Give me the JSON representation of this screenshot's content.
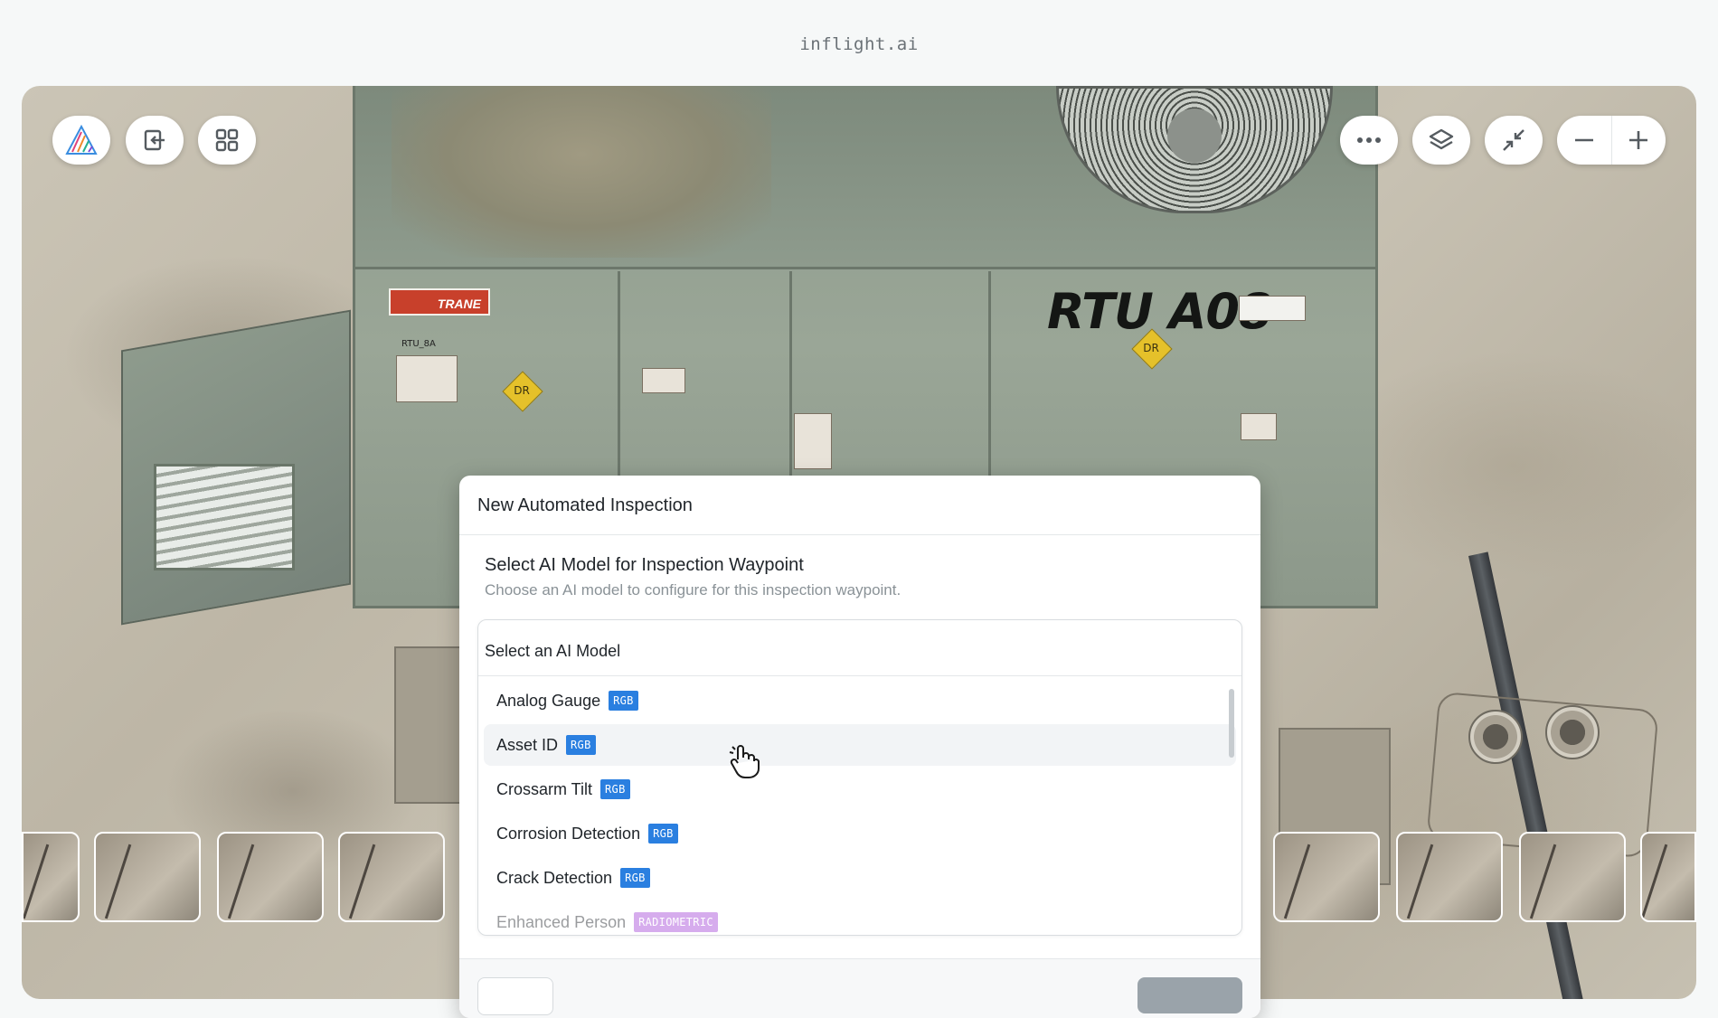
{
  "site": {
    "title": "inflight.ai"
  },
  "scene": {
    "unit_label": "RTU A08",
    "brand_label": "TRANE",
    "unit_small_label": "RTU_8A",
    "badge_label": "DR"
  },
  "toolbar": {
    "left_icons": [
      "logo-icon",
      "exit-icon",
      "grid-icon"
    ],
    "right_icons": [
      "more-icon",
      "layers-icon",
      "collapse-icon",
      "zoom-out-icon",
      "zoom-in-icon"
    ]
  },
  "modal": {
    "title": "New Automated Inspection",
    "section_title": "Select AI Model for Inspection Waypoint",
    "section_description": "Choose an AI model to configure for this inspection waypoint.",
    "select_placeholder": "Select an AI Model",
    "models": [
      {
        "name": "Analog Gauge",
        "tag": "RGB"
      },
      {
        "name": "Asset ID",
        "tag": "RGB"
      },
      {
        "name": "Crossarm Tilt",
        "tag": "RGB"
      },
      {
        "name": "Corrosion Detection",
        "tag": "RGB"
      },
      {
        "name": "Crack Detection",
        "tag": "RGB"
      },
      {
        "name": "Enhanced Person",
        "tag": "RADIOMETRIC"
      }
    ]
  },
  "colors": {
    "rgb_tag": "#2a7fe0",
    "radiometric_tag": "#a54ad8",
    "hover_row": "#f2f4f6"
  }
}
